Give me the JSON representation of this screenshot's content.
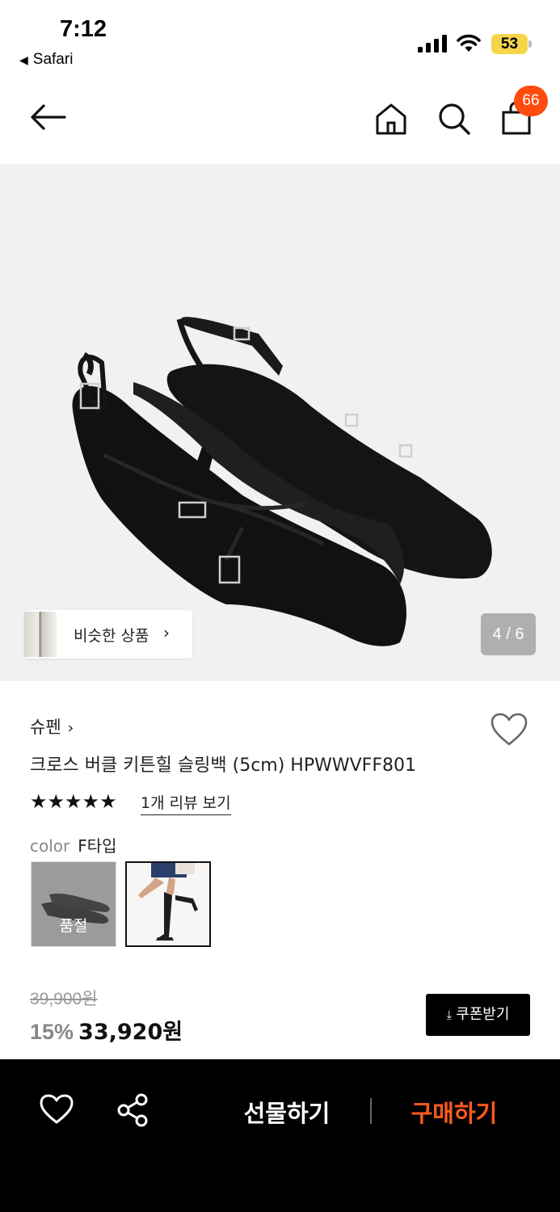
{
  "status_bar": {
    "time": "7:12",
    "back_app_label": "Safari",
    "battery_level": "53",
    "battery_color": "#f6d54a"
  },
  "header": {
    "back_icon": "arrow-left-icon",
    "home_icon": "home-icon",
    "search_icon": "search-icon",
    "cart_icon": "shopping-bag-icon",
    "cart_count": "66",
    "badge_color": "#ff4b0f"
  },
  "gallery": {
    "similar_products_label": "비슷한 상품",
    "page_indicator": "4 / 6"
  },
  "product": {
    "brand": "슈펜",
    "title": "크로스 버클 키튼힐 슬링백 (5cm) HPWWVFF801",
    "rating_stars": 5,
    "stars_text": "★★★★★",
    "review_link": "1개 리뷰 보기",
    "option_name": "color",
    "option_value": "F타입",
    "swatch_soldout_label": "품절"
  },
  "price": {
    "original": "39,900원",
    "discount": "15%",
    "sale": "33,920원",
    "coupon_label": "쿠폰받기"
  },
  "bottom_bar": {
    "like_icon": "heart-icon",
    "share_icon": "share-icon",
    "gift_label": "선물하기",
    "buy_label": "구매하기",
    "buy_color": "#ff5a1f"
  }
}
